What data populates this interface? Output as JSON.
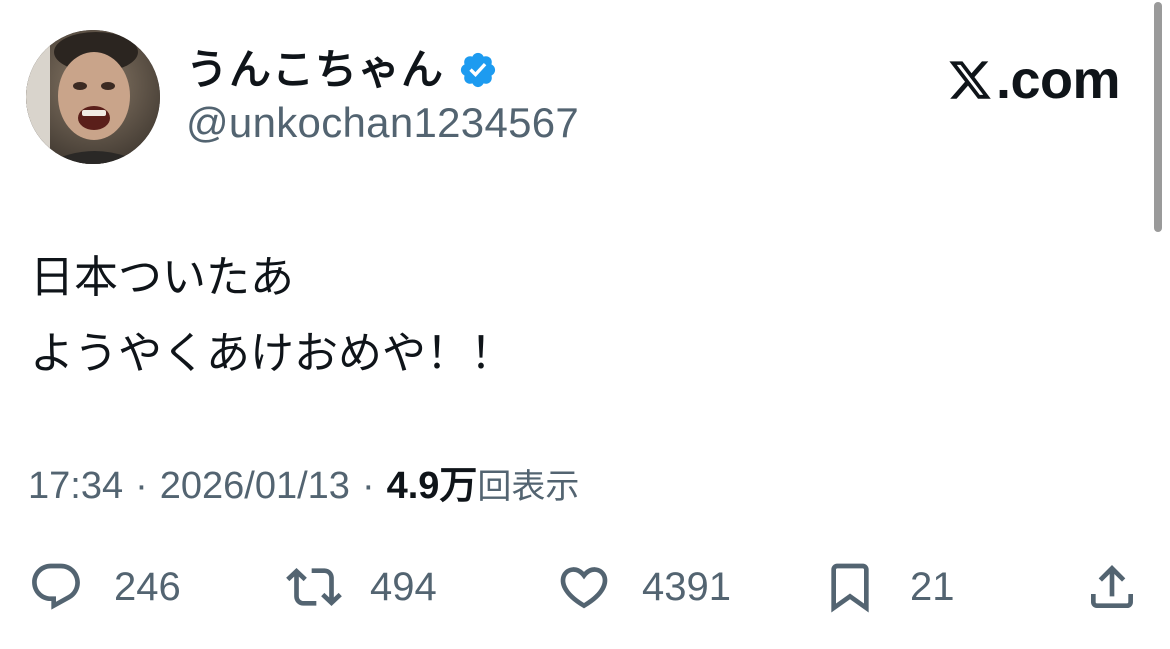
{
  "author": {
    "display_name": "うんこちゃん",
    "handle": "@unkochan1234567",
    "verified": true,
    "avatar_icon": "profile-photo"
  },
  "brand": {
    "text": ".com",
    "logo_icon": "x-logo-icon"
  },
  "tweet": {
    "lines": [
      "日本ついたあ",
      "ようやくあけおめや！！"
    ]
  },
  "meta": {
    "time": "17:34",
    "separator": "·",
    "date": "2026/01/13",
    "views_count": "4.9万",
    "views_label": "回表示"
  },
  "actions": {
    "reply": {
      "icon": "reply-icon",
      "count": "246"
    },
    "repost": {
      "icon": "repost-icon",
      "count": "494"
    },
    "like": {
      "icon": "heart-icon",
      "count": "4391"
    },
    "bookmark": {
      "icon": "bookmark-icon",
      "count": "21"
    },
    "share": {
      "icon": "share-icon"
    }
  },
  "colors": {
    "text_primary": "#0f1419",
    "text_secondary": "#536471",
    "verified_blue": "#1d9bf0"
  }
}
